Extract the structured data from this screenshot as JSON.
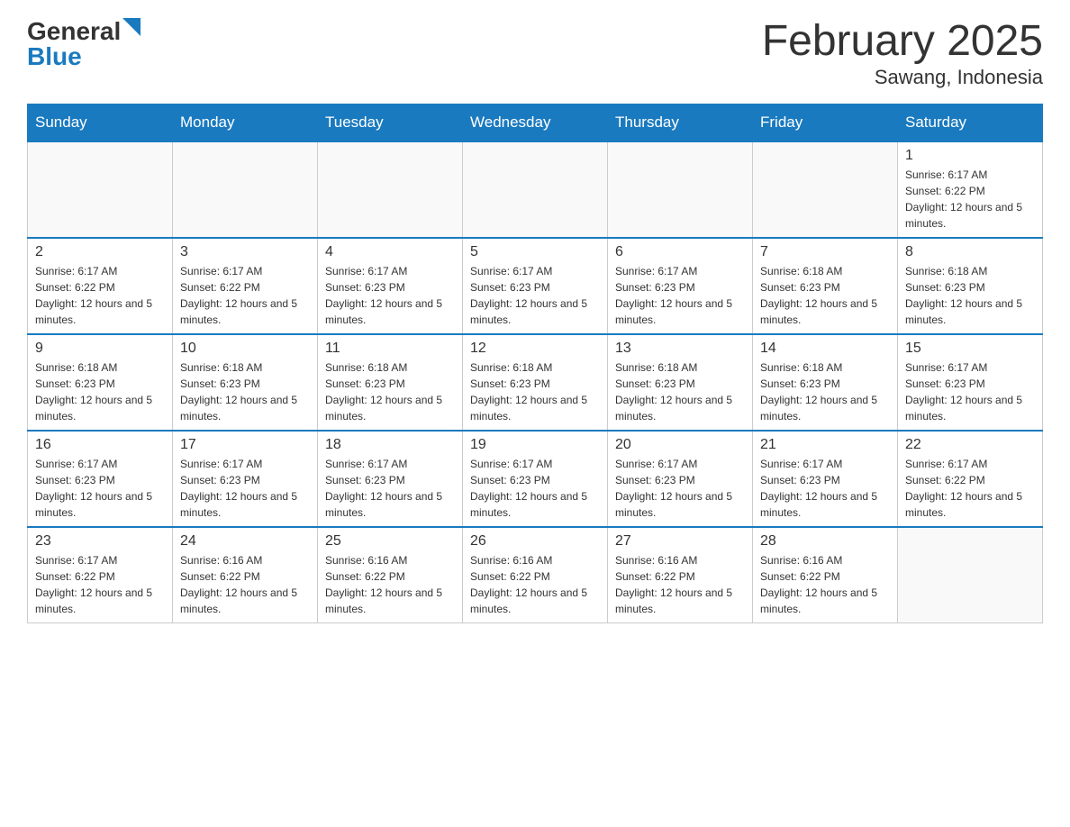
{
  "header": {
    "logo": {
      "general": "General",
      "blue": "Blue",
      "arrow": "▶"
    },
    "month_title": "February 2025",
    "location": "Sawang, Indonesia"
  },
  "days_of_week": [
    "Sunday",
    "Monday",
    "Tuesday",
    "Wednesday",
    "Thursday",
    "Friday",
    "Saturday"
  ],
  "weeks": [
    {
      "days": [
        {
          "number": "",
          "info": ""
        },
        {
          "number": "",
          "info": ""
        },
        {
          "number": "",
          "info": ""
        },
        {
          "number": "",
          "info": ""
        },
        {
          "number": "",
          "info": ""
        },
        {
          "number": "",
          "info": ""
        },
        {
          "number": "1",
          "info": "Sunrise: 6:17 AM\nSunset: 6:22 PM\nDaylight: 12 hours and 5 minutes."
        }
      ]
    },
    {
      "days": [
        {
          "number": "2",
          "info": "Sunrise: 6:17 AM\nSunset: 6:22 PM\nDaylight: 12 hours and 5 minutes."
        },
        {
          "number": "3",
          "info": "Sunrise: 6:17 AM\nSunset: 6:22 PM\nDaylight: 12 hours and 5 minutes."
        },
        {
          "number": "4",
          "info": "Sunrise: 6:17 AM\nSunset: 6:23 PM\nDaylight: 12 hours and 5 minutes."
        },
        {
          "number": "5",
          "info": "Sunrise: 6:17 AM\nSunset: 6:23 PM\nDaylight: 12 hours and 5 minutes."
        },
        {
          "number": "6",
          "info": "Sunrise: 6:17 AM\nSunset: 6:23 PM\nDaylight: 12 hours and 5 minutes."
        },
        {
          "number": "7",
          "info": "Sunrise: 6:18 AM\nSunset: 6:23 PM\nDaylight: 12 hours and 5 minutes."
        },
        {
          "number": "8",
          "info": "Sunrise: 6:18 AM\nSunset: 6:23 PM\nDaylight: 12 hours and 5 minutes."
        }
      ]
    },
    {
      "days": [
        {
          "number": "9",
          "info": "Sunrise: 6:18 AM\nSunset: 6:23 PM\nDaylight: 12 hours and 5 minutes."
        },
        {
          "number": "10",
          "info": "Sunrise: 6:18 AM\nSunset: 6:23 PM\nDaylight: 12 hours and 5 minutes."
        },
        {
          "number": "11",
          "info": "Sunrise: 6:18 AM\nSunset: 6:23 PM\nDaylight: 12 hours and 5 minutes."
        },
        {
          "number": "12",
          "info": "Sunrise: 6:18 AM\nSunset: 6:23 PM\nDaylight: 12 hours and 5 minutes."
        },
        {
          "number": "13",
          "info": "Sunrise: 6:18 AM\nSunset: 6:23 PM\nDaylight: 12 hours and 5 minutes."
        },
        {
          "number": "14",
          "info": "Sunrise: 6:18 AM\nSunset: 6:23 PM\nDaylight: 12 hours and 5 minutes."
        },
        {
          "number": "15",
          "info": "Sunrise: 6:17 AM\nSunset: 6:23 PM\nDaylight: 12 hours and 5 minutes."
        }
      ]
    },
    {
      "days": [
        {
          "number": "16",
          "info": "Sunrise: 6:17 AM\nSunset: 6:23 PM\nDaylight: 12 hours and 5 minutes."
        },
        {
          "number": "17",
          "info": "Sunrise: 6:17 AM\nSunset: 6:23 PM\nDaylight: 12 hours and 5 minutes."
        },
        {
          "number": "18",
          "info": "Sunrise: 6:17 AM\nSunset: 6:23 PM\nDaylight: 12 hours and 5 minutes."
        },
        {
          "number": "19",
          "info": "Sunrise: 6:17 AM\nSunset: 6:23 PM\nDaylight: 12 hours and 5 minutes."
        },
        {
          "number": "20",
          "info": "Sunrise: 6:17 AM\nSunset: 6:23 PM\nDaylight: 12 hours and 5 minutes."
        },
        {
          "number": "21",
          "info": "Sunrise: 6:17 AM\nSunset: 6:23 PM\nDaylight: 12 hours and 5 minutes."
        },
        {
          "number": "22",
          "info": "Sunrise: 6:17 AM\nSunset: 6:22 PM\nDaylight: 12 hours and 5 minutes."
        }
      ]
    },
    {
      "days": [
        {
          "number": "23",
          "info": "Sunrise: 6:17 AM\nSunset: 6:22 PM\nDaylight: 12 hours and 5 minutes."
        },
        {
          "number": "24",
          "info": "Sunrise: 6:16 AM\nSunset: 6:22 PM\nDaylight: 12 hours and 5 minutes."
        },
        {
          "number": "25",
          "info": "Sunrise: 6:16 AM\nSunset: 6:22 PM\nDaylight: 12 hours and 5 minutes."
        },
        {
          "number": "26",
          "info": "Sunrise: 6:16 AM\nSunset: 6:22 PM\nDaylight: 12 hours and 5 minutes."
        },
        {
          "number": "27",
          "info": "Sunrise: 6:16 AM\nSunset: 6:22 PM\nDaylight: 12 hours and 5 minutes."
        },
        {
          "number": "28",
          "info": "Sunrise: 6:16 AM\nSunset: 6:22 PM\nDaylight: 12 hours and 5 minutes."
        },
        {
          "number": "",
          "info": ""
        }
      ]
    }
  ]
}
